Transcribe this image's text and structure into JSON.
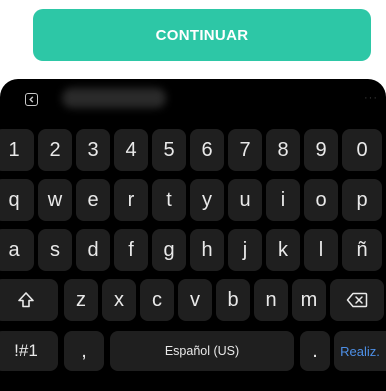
{
  "continue_button": {
    "label": "CONTINUAR"
  },
  "keyboard": {
    "toolbar": {
      "back_icon": "chevron-left-square-icon",
      "more_icon": "ellipsis-icon",
      "more_text": "···"
    },
    "rows": [
      [
        "1",
        "2",
        "3",
        "4",
        "5",
        "6",
        "7",
        "8",
        "9",
        "0"
      ],
      [
        "q",
        "w",
        "e",
        "r",
        "t",
        "y",
        "u",
        "i",
        "o",
        "p"
      ],
      [
        "a",
        "s",
        "d",
        "f",
        "g",
        "h",
        "j",
        "k",
        "l",
        "ñ"
      ],
      [
        "z",
        "x",
        "c",
        "v",
        "b",
        "n",
        "m"
      ]
    ],
    "shift_icon": "shift-icon",
    "backspace_icon": "backspace-icon",
    "symbols_label": "!#1",
    "comma_label": ",",
    "space_label": "Español (US)",
    "period_label": ".",
    "enter_label": "Realiz."
  },
  "colors": {
    "accent": "#2dc7a6",
    "keyboard_bg": "#000000",
    "key_bg": "#1f1f1f",
    "key_text": "#e9e9e9",
    "enter_text": "#4d8fe6"
  }
}
